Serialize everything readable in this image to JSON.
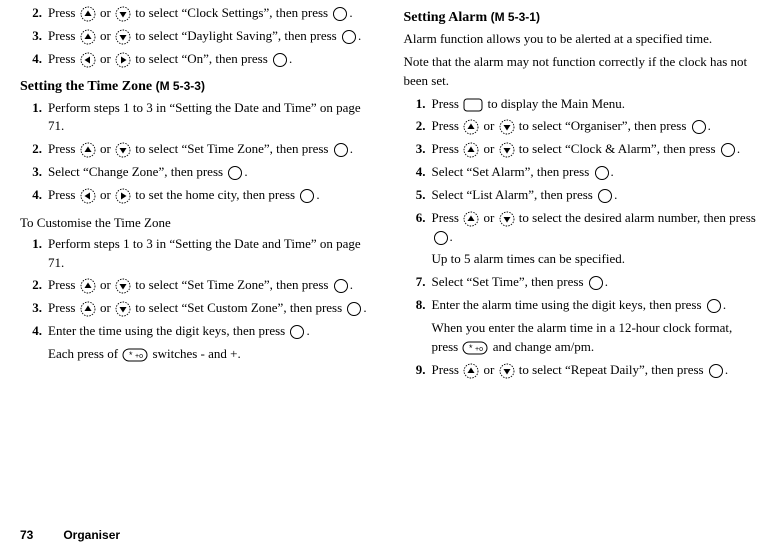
{
  "left": {
    "pre_steps": [
      {
        "n": "2.",
        "text": "Press {up} or {down} to select “Clock Settings”, then press {ok}."
      },
      {
        "n": "3.",
        "text": "Press {up} or {down} to select “Daylight Saving”, then press {ok}."
      },
      {
        "n": "4.",
        "text": "Press {left} or {right} to select “On”, then press {ok}."
      }
    ],
    "h1": {
      "title": "Setting the Time Zone",
      "code": "(M 5-3-3)"
    },
    "tz_steps": [
      {
        "n": "1.",
        "text": "Perform steps 1 to 3 in “Setting the Date and Time” on page 71."
      },
      {
        "n": "2.",
        "text": "Press {up} or {down} to select “Set Time Zone”, then press {ok}."
      },
      {
        "n": "3.",
        "text": "Select “Change Zone”, then press {ok}."
      },
      {
        "n": "4.",
        "text": "Press {left} or {right} to set the home city, then press {ok}."
      }
    ],
    "h2": {
      "title": "To Customise the Time Zone"
    },
    "custom_steps": [
      {
        "n": "1.",
        "text": "Perform steps 1 to 3 in “Setting the Date and Time” on page 71."
      },
      {
        "n": "2.",
        "text": "Press {up} or {down} to select “Set Time Zone”, then press {ok}."
      },
      {
        "n": "3.",
        "text": "Press {up} or {down} to select “Set Custom Zone”, then press {ok}."
      },
      {
        "n": "4.",
        "text": "Enter the time using the digit keys, then press {ok}.",
        "cont": "Each press of {star} switches - and +."
      }
    ]
  },
  "right": {
    "h1": {
      "title": "Setting Alarm",
      "code": "(M 5-3-1)"
    },
    "intro1": "Alarm function allows you to be alerted at a specified time.",
    "intro2": "Note that the alarm may not function correctly if the clock has not been set.",
    "steps": [
      {
        "n": "1.",
        "text": "Press {menu} to display the Main Menu."
      },
      {
        "n": "2.",
        "text": "Press {up} or {down} to select “Organiser”, then press {ok}."
      },
      {
        "n": "3.",
        "text": "Press {up} or {down} to select “Clock & Alarm”, then press {ok}."
      },
      {
        "n": "4.",
        "text": "Select “Set Alarm”, then press {ok}."
      },
      {
        "n": "5.",
        "text": "Select “List Alarm”, then press {ok}."
      },
      {
        "n": "6.",
        "text": "Press {up} or {down} to select the desired alarm number, then press {ok}.",
        "cont": "Up to 5 alarm times can be specified."
      },
      {
        "n": "7.",
        "text": "Select “Set Time”, then press {ok}."
      },
      {
        "n": "8.",
        "text": "Enter the alarm time using the digit keys, then press {ok}.",
        "cont": "When you enter the alarm time in a 12-hour clock format, press {star} and change am/pm."
      },
      {
        "n": "9.",
        "text": "Press {up} or {down} to select “Repeat Daily”, then press {ok}."
      }
    ]
  },
  "footer": {
    "page": "73",
    "section": "Organiser"
  }
}
